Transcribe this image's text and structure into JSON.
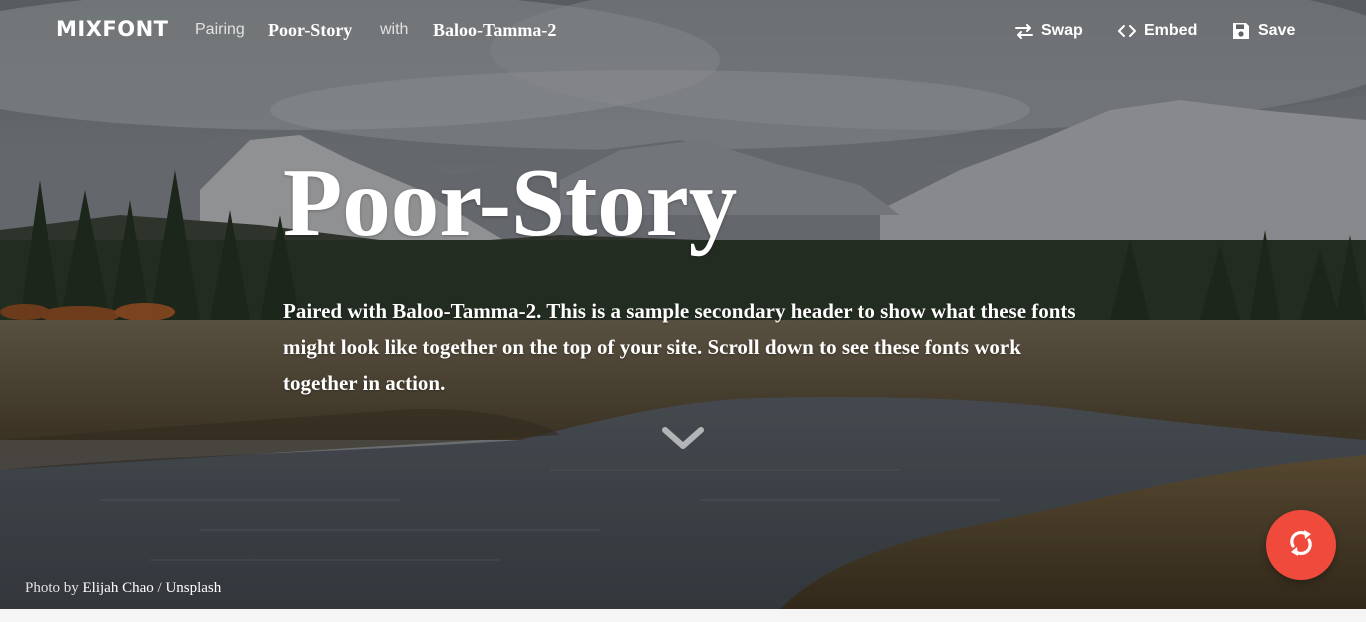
{
  "brand": {
    "logo": "MIXFONT"
  },
  "pairing": {
    "label": "Pairing",
    "heading_font": "Poor-Story",
    "with_label": "with",
    "body_font": "Baloo-Tamma-2"
  },
  "actions": {
    "swap": {
      "label": "Swap",
      "icon": "swap-arrows-icon"
    },
    "embed": {
      "label": "Embed",
      "icon": "code-brackets-icon"
    },
    "save": {
      "label": "Save",
      "icon": "floppy-disk-icon"
    }
  },
  "hero": {
    "title": "Poor-Story",
    "subtitle": "Paired with Baloo-Tamma-2. This is a sample secondary header to show what these fonts might look like together on the top of your site. Scroll down to see these fonts work together in action.",
    "scroll_icon": "chevron-down-icon"
  },
  "credit": {
    "prefix": "Photo by",
    "author": "Elijah Chao",
    "separator": "/",
    "source": "Unsplash"
  },
  "fab": {
    "icon": "refresh-icon",
    "color": "#ef4a3c"
  }
}
